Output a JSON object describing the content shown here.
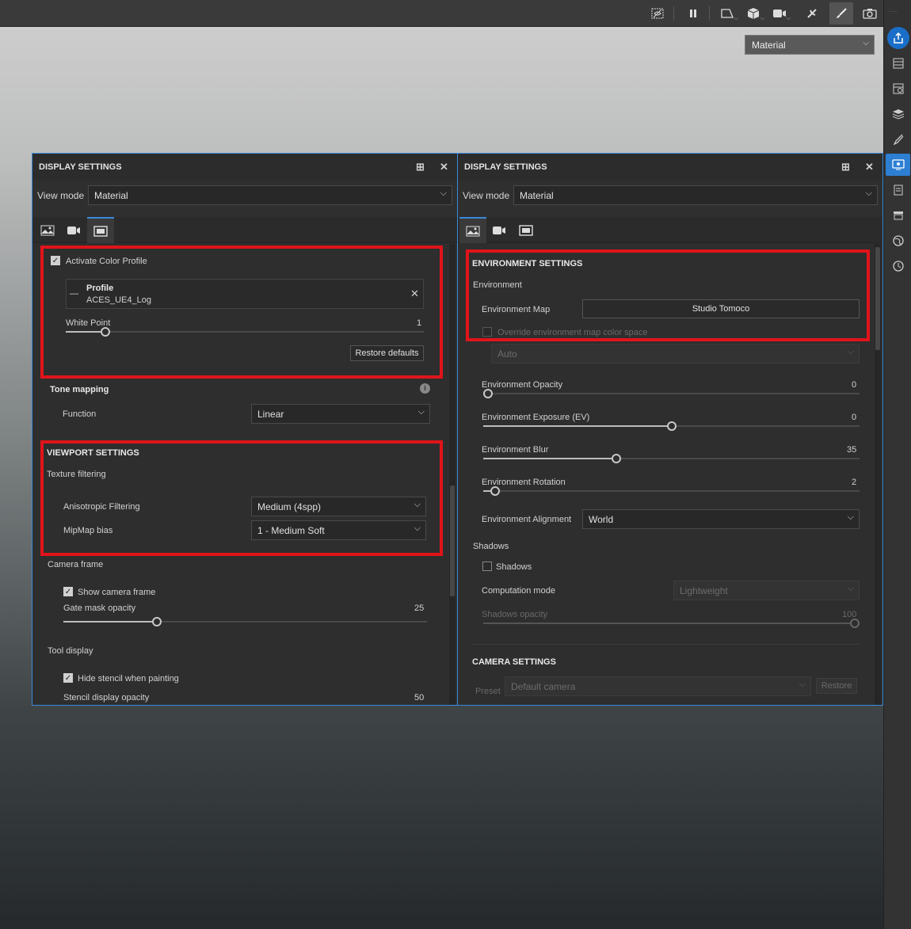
{
  "viewport": {
    "mode_select": "Material"
  },
  "toolbar": {
    "icons": [
      "hidden-icon",
      "pause-icon",
      "frame-icon",
      "cube-icon",
      "camera-video-icon",
      "fx-icon",
      "brush-icon",
      "screenshot-icon"
    ]
  },
  "right_sidebar": {
    "tiny_label": "......",
    "icons": [
      "share-icon",
      "layers-list-icon",
      "texture-set-icon",
      "stack-icon",
      "brush-settings-icon",
      "display-settings-icon",
      "properties-icon",
      "shelf-icon",
      "globe-icon",
      "history-icon"
    ]
  },
  "panel_left": {
    "title": "DISPLAY SETTINGS",
    "view_mode_label": "View mode",
    "view_mode_value": "Material",
    "tabs": [
      "environment-tab",
      "camera-tab",
      "viewport-tab"
    ],
    "color_profile": {
      "activate_label": "Activate Color Profile",
      "activate_checked": true,
      "profile_label": "Profile",
      "profile_value": "ACES_UE4_Log",
      "profile_dash": "—",
      "white_point_label": "White Point",
      "white_point_value": "1",
      "white_point_level": 0.1,
      "restore_label": "Restore defaults"
    },
    "tone_mapping": {
      "title": "Tone mapping",
      "function_label": "Function",
      "function_value": "Linear"
    },
    "viewport_settings": {
      "title": "VIEWPORT SETTINGS",
      "texture_filtering": "Texture filtering",
      "aniso_label": "Anisotropic Filtering",
      "aniso_value": "Medium (4spp)",
      "mipmap_label": "MipMap bias",
      "mipmap_value": "1 - Medium Soft"
    },
    "camera_frame": {
      "title": "Camera frame",
      "show_label": "Show camera frame",
      "show_checked": true,
      "gate_label": "Gate mask opacity",
      "gate_value": "25",
      "gate_level": 0.25
    },
    "tool_display": {
      "title": "Tool display",
      "hide_stencil_label": "Hide stencil when painting",
      "hide_stencil_checked": true,
      "stencil_opacity_label": "Stencil display opacity",
      "stencil_opacity_value": "50"
    }
  },
  "panel_right": {
    "title": "DISPLAY SETTINGS",
    "view_mode_label": "View mode",
    "view_mode_value": "Material",
    "tabs": [
      "environment-tab",
      "camera-tab",
      "viewport-tab"
    ],
    "environment_settings": {
      "title": "ENVIRONMENT SETTINGS",
      "environment_label": "Environment",
      "env_map_label": "Environment Map",
      "env_map_value": "Studio Tomoco",
      "override_label": "Override environment map color space",
      "override_checked": false,
      "colorspace_value": "Auto",
      "opacity_label": "Environment Opacity",
      "opacity_value": "0",
      "opacity_level": 0.0,
      "exposure_label": "Environment Exposure (EV)",
      "exposure_value": "0",
      "exposure_level": 0.5,
      "blur_label": "Environment Blur",
      "blur_value": "35",
      "blur_level": 0.35,
      "rotation_label": "Environment Rotation",
      "rotation_value": "2",
      "rotation_level": 0.02,
      "alignment_label": "Environment Alignment",
      "alignment_value": "World"
    },
    "shadows": {
      "title": "Shadows",
      "shadows_label": "Shadows",
      "shadows_checked": false,
      "computation_label": "Computation mode",
      "computation_value": "Lightweight",
      "opacity_label": "Shadows opacity",
      "opacity_value": "100",
      "opacity_level": 1.0
    },
    "camera_settings": {
      "title": "CAMERA SETTINGS",
      "preset_label": "Preset",
      "preset_value": "Default camera",
      "restore_label": "Restore"
    }
  }
}
